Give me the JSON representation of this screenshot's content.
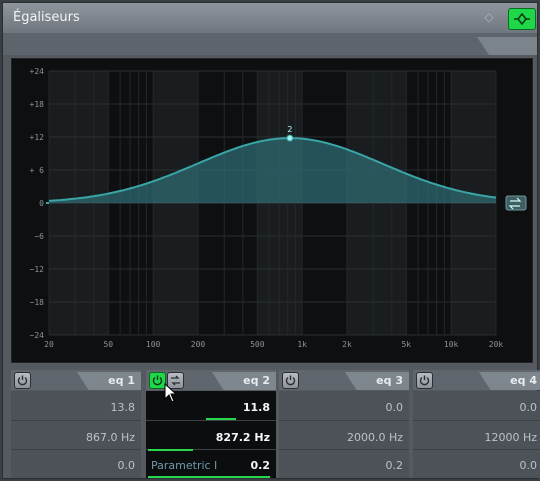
{
  "window": {
    "title": "Égaliseurs"
  },
  "graph": {
    "y_ticks": [
      "+24",
      "+18",
      "+12",
      "+ 6",
      "0",
      "−6",
      "−12",
      "−18",
      "−24"
    ],
    "x_ticks": [
      "20",
      "50",
      "100",
      "200",
      "500",
      "1k",
      "2k",
      "5k",
      "10k",
      "20k"
    ],
    "point_label": "2",
    "accent": "#3aa5a7"
  },
  "bands": [
    {
      "name": "eq 1",
      "gain": "13.8",
      "freq": "867.0 Hz",
      "q": "0.0",
      "enabled": false
    },
    {
      "name": "eq 2",
      "gain": "11.8",
      "freq": "827.2 Hz",
      "q": "0.2",
      "type": "Parametric I",
      "enabled": true,
      "active": true
    },
    {
      "name": "eq 3",
      "gain": "0.0",
      "freq": "2000.0 Hz",
      "q": "0.2",
      "enabled": false
    },
    {
      "name": "eq 4",
      "gain": "0.0",
      "freq": "12000 Hz",
      "q": "0.0",
      "enabled": false
    }
  ]
}
